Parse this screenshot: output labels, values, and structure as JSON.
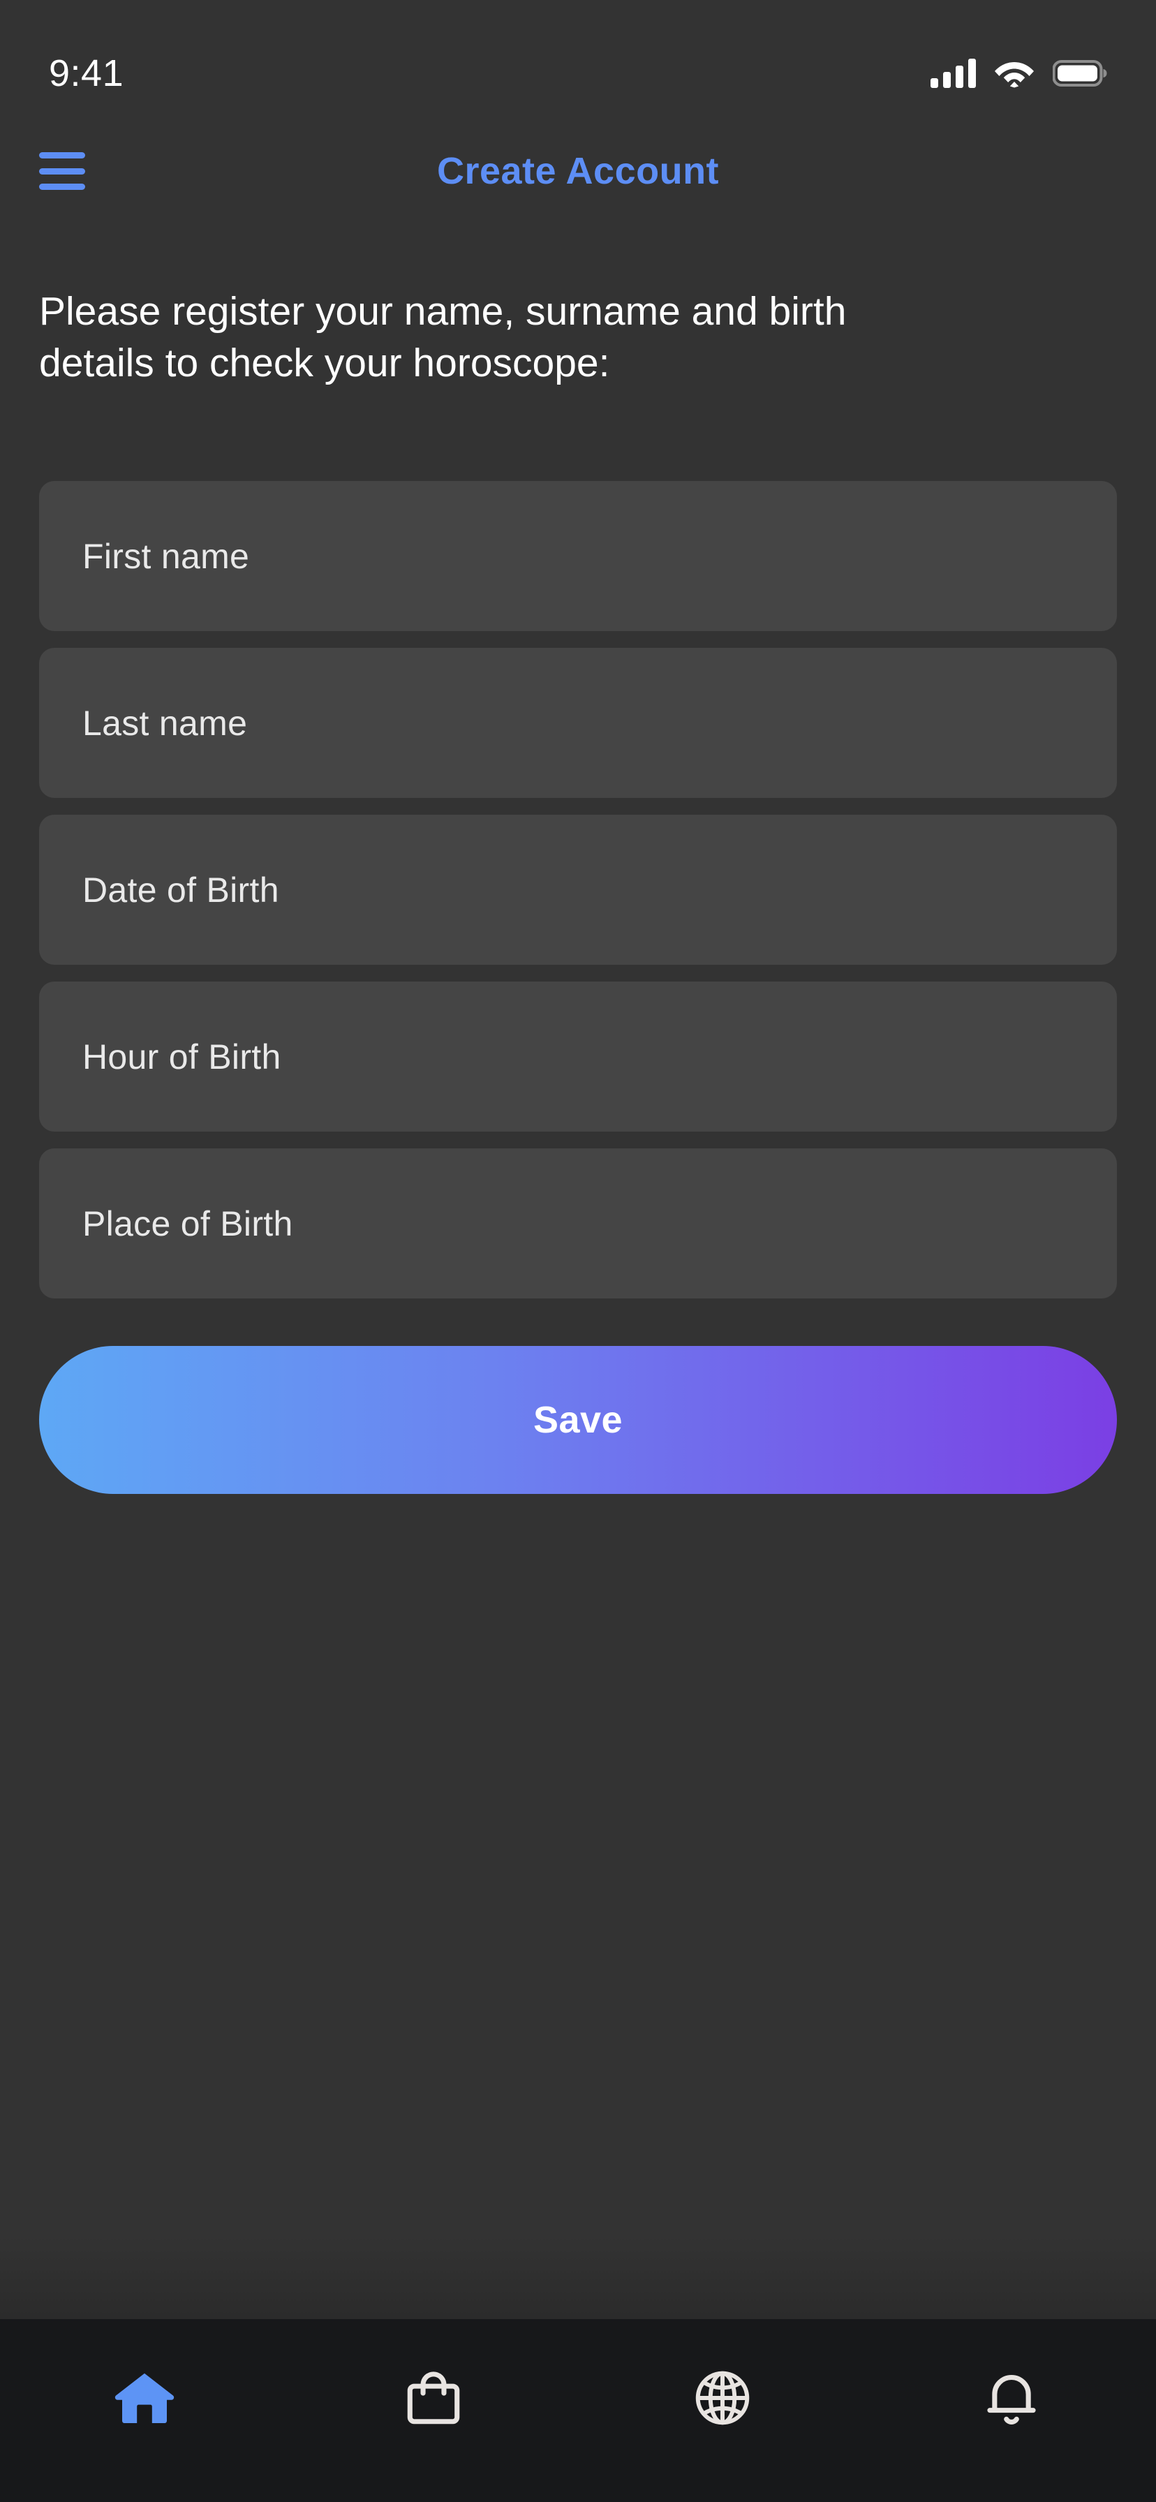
{
  "status_bar": {
    "time": "9:41",
    "signal_icon": "cellular-signal-icon",
    "wifi_icon": "wifi-icon",
    "battery_icon": "battery-full-icon"
  },
  "header": {
    "menu_icon": "hamburger-menu-icon",
    "title": "Create Account",
    "title_color": "#5D8EF5"
  },
  "main": {
    "intro_text": "Please register your name, surname and birth details to check your horoscope:",
    "fields": [
      {
        "name": "first-name",
        "placeholder": "First name",
        "value": ""
      },
      {
        "name": "last-name",
        "placeholder": "Last name",
        "value": ""
      },
      {
        "name": "date-of-birth",
        "placeholder": "Date of Birth",
        "value": ""
      },
      {
        "name": "hour-of-birth",
        "placeholder": "Hour of Birth",
        "value": ""
      },
      {
        "name": "place-of-birth",
        "placeholder": "Place of Birth",
        "value": ""
      }
    ],
    "save_button": {
      "label": "Save",
      "gradient_start": "#5EA8F5",
      "gradient_end": "#7B3FE4"
    }
  },
  "bottom_nav": {
    "background": "#17181A",
    "active_color": "#5D94F5",
    "inactive_color": "#E8E4E1",
    "items": [
      {
        "name": "nav-home",
        "icon": "home-icon",
        "active": true
      },
      {
        "name": "nav-shop",
        "icon": "shopping-bag-icon",
        "active": false
      },
      {
        "name": "nav-globe",
        "icon": "globe-icon",
        "active": false
      },
      {
        "name": "nav-notifications",
        "icon": "bell-icon",
        "active": false
      }
    ]
  },
  "theme": {
    "page_background": "#333333",
    "field_background": "#454545",
    "text_primary": "#FFFFFF",
    "text_field": "#E9E9E9"
  }
}
